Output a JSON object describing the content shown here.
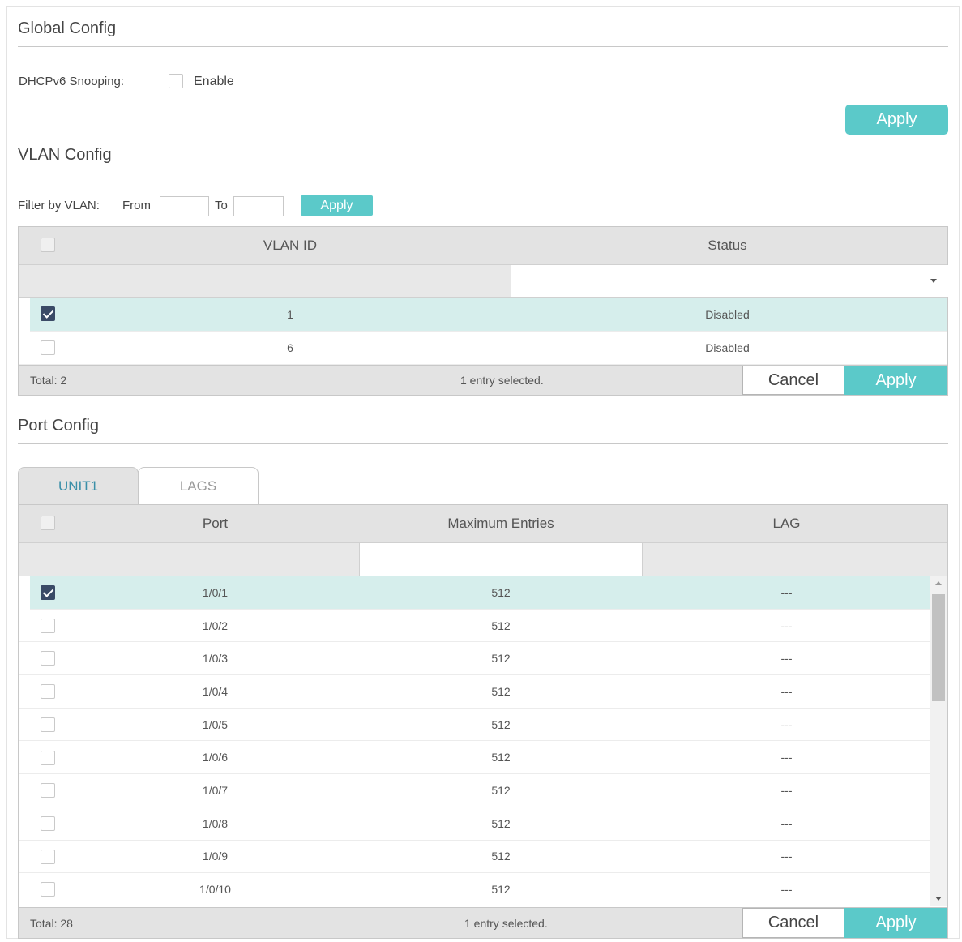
{
  "global_config": {
    "title": "Global Config",
    "dhcpv6_label": "DHCPv6 Snooping:",
    "enable_label": "Enable",
    "enable_checked": false,
    "apply_label": "Apply"
  },
  "vlan_config": {
    "title": "VLAN Config",
    "filter_label": "Filter by VLAN:",
    "from_label": "From",
    "from_value": "",
    "to_label": "To",
    "to_value": "",
    "filter_apply_label": "Apply",
    "columns": [
      "VLAN ID",
      "Status"
    ],
    "rows": [
      {
        "vlan_id": "1",
        "status": "Disabled",
        "selected": true
      },
      {
        "vlan_id": "6",
        "status": "Disabled",
        "selected": false
      }
    ],
    "total": "Total: 2",
    "selected_text": "1 entry selected.",
    "cancel_label": "Cancel",
    "apply_label": "Apply"
  },
  "port_config": {
    "title": "Port Config",
    "tabs": [
      {
        "label": "UNIT1",
        "active": true
      },
      {
        "label": "LAGS",
        "active": false
      }
    ],
    "columns": [
      "Port",
      "Maximum Entries",
      "LAG"
    ],
    "rows": [
      {
        "port": "1/0/1",
        "max": "512",
        "lag": "---",
        "selected": true
      },
      {
        "port": "1/0/2",
        "max": "512",
        "lag": "---",
        "selected": false
      },
      {
        "port": "1/0/3",
        "max": "512",
        "lag": "---",
        "selected": false
      },
      {
        "port": "1/0/4",
        "max": "512",
        "lag": "---",
        "selected": false
      },
      {
        "port": "1/0/5",
        "max": "512",
        "lag": "---",
        "selected": false
      },
      {
        "port": "1/0/6",
        "max": "512",
        "lag": "---",
        "selected": false
      },
      {
        "port": "1/0/7",
        "max": "512",
        "lag": "---",
        "selected": false
      },
      {
        "port": "1/0/8",
        "max": "512",
        "lag": "---",
        "selected": false
      },
      {
        "port": "1/0/9",
        "max": "512",
        "lag": "---",
        "selected": false
      },
      {
        "port": "1/0/10",
        "max": "512",
        "lag": "---",
        "selected": false
      }
    ],
    "total": "Total: 28",
    "selected_text": "1 entry selected.",
    "cancel_label": "Cancel",
    "apply_label": "Apply"
  },
  "colors": {
    "accent": "#5bc9c9",
    "selected_row": "#d6eeec",
    "header_bg": "#e3e3e3",
    "checkbox_checked": "#3a4a66"
  }
}
